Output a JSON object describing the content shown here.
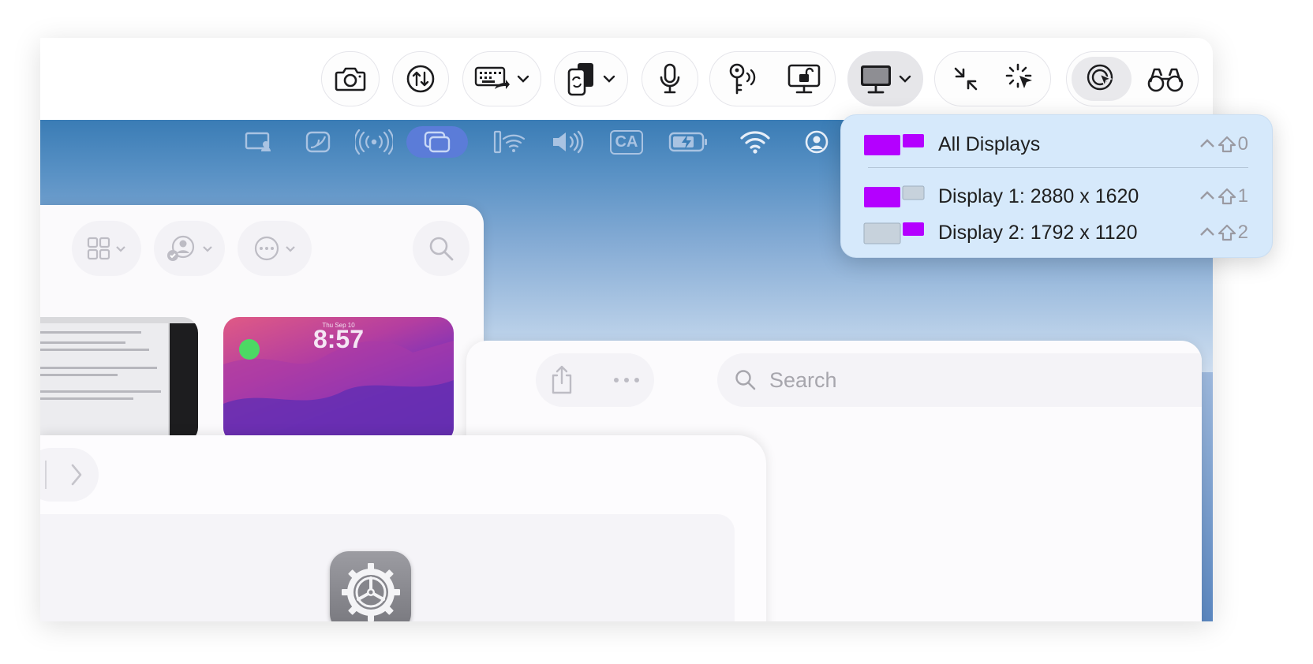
{
  "search": {
    "placeholder": "Search"
  },
  "lockscreen": {
    "date": "Thu Sep 10",
    "time": "8:57"
  },
  "menubar": {
    "ca_label": "CA"
  },
  "display_menu": {
    "items": [
      {
        "label": "All Displays",
        "shortcut_key": "0",
        "left_color": "#b400ff",
        "right_color": "#b400ff"
      },
      {
        "label": "Display 1: 2880 x 1620",
        "shortcut_key": "1",
        "left_color": "#b400ff",
        "right_color": "#c7d2dc"
      },
      {
        "label": "Display 2: 1792 x 1120",
        "shortcut_key": "2",
        "left_color": "#c7d2dc",
        "right_color": "#b400ff"
      }
    ]
  },
  "colors": {
    "accent_purple": "#b400ff",
    "swatch_gray": "#c7d2dc",
    "menubar_blue": "#3a7cb5"
  }
}
